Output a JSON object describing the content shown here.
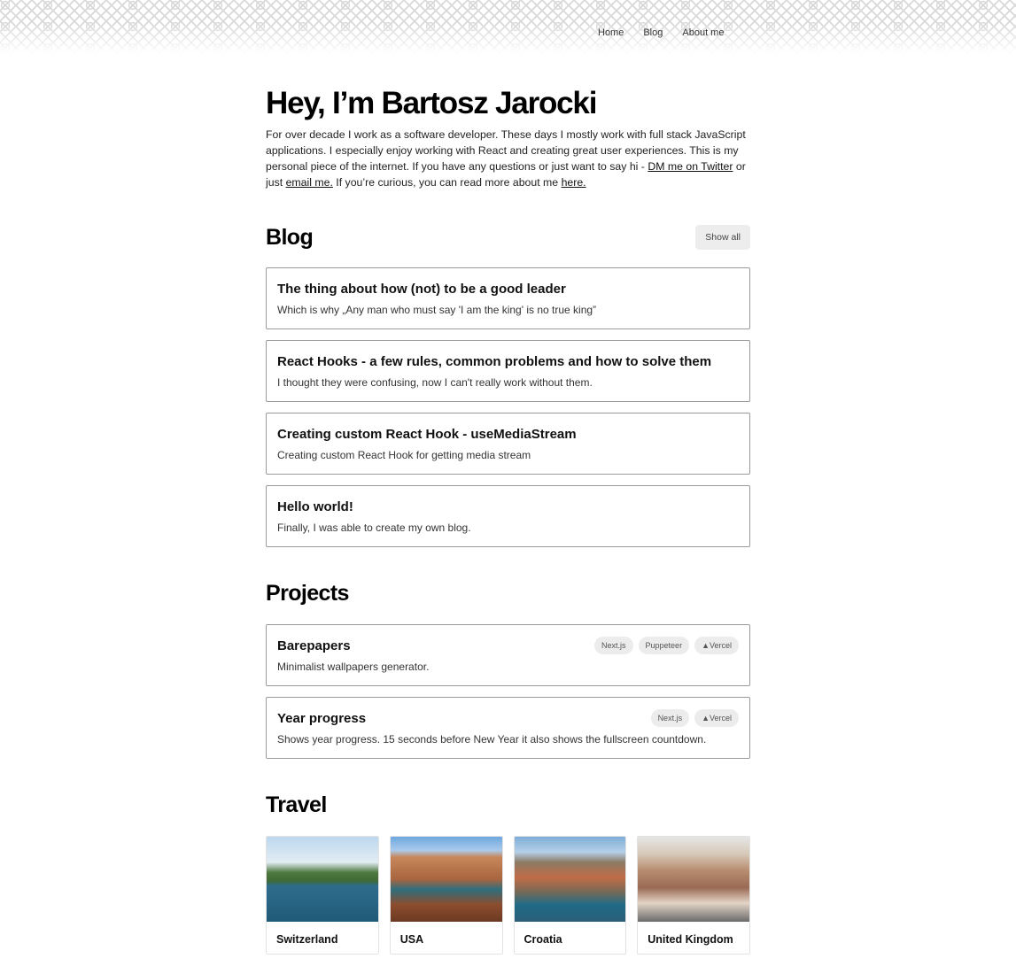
{
  "nav": {
    "items": [
      "Home",
      "Blog",
      "About me"
    ]
  },
  "intro": {
    "title": "Hey, I’m Bartosz Jarocki",
    "text_before_twitter": "For over decade I work as a software developer. These days I mostly work with full stack JavaScript applications. I especially enjoy working with React and creating great user experiences. This is my personal piece of the internet. If you have any questions or just want to say hi - ",
    "twitter_link": "DM me on Twitter",
    "text_or_just": " or just ",
    "email_link": "email me.",
    "text_curious": " If you’re curious, you can read more about me ",
    "here_link": "here."
  },
  "blog": {
    "heading": "Blog",
    "show_all": "Show all",
    "posts": [
      {
        "title": "The thing about how (not) to be a good leader",
        "description": "Which is why „Any man who must say 'I am the king' is no true king”"
      },
      {
        "title": "React Hooks - a few rules, common problems and how to solve them",
        "description": "I thought they were confusing, now I can't really work without them."
      },
      {
        "title": "Creating custom React Hook - useMediaStream",
        "description": "Creating custom React Hook for getting media stream"
      },
      {
        "title": "Hello world!",
        "description": "Finally, I was able to create my own blog."
      }
    ]
  },
  "projects": {
    "heading": "Projects",
    "items": [
      {
        "title": "Barepapers",
        "description": "Minimalist wallpapers generator.",
        "tags": [
          "Next.js",
          "Puppeteer",
          "▲Vercel"
        ]
      },
      {
        "title": "Year progress",
        "description": "Shows year progress. 15 seconds before New Year it also shows the fullscreen countdown.",
        "tags": [
          "Next.js",
          "▲Vercel"
        ]
      }
    ]
  },
  "travel": {
    "heading": "Travel",
    "places": [
      "Switzerland",
      "USA",
      "Croatia",
      "United Kingdom"
    ]
  }
}
